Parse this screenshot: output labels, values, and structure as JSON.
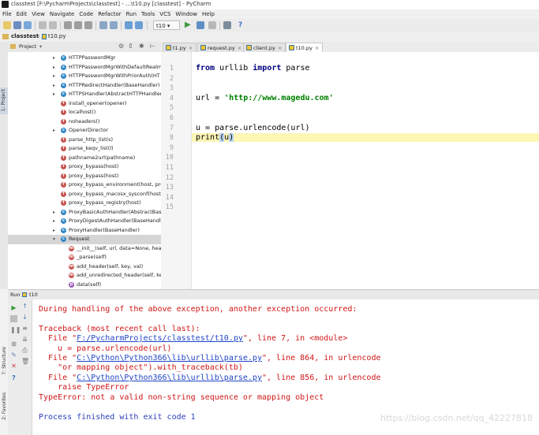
{
  "window": {
    "title": "classtest [F:\\PycharmProjects\\classtest] - ...\\t10.py [classtest] - PyCharm"
  },
  "menu": [
    "File",
    "Edit",
    "View",
    "Navigate",
    "Code",
    "Refactor",
    "Run",
    "Tools",
    "VCS",
    "Window",
    "Help"
  ],
  "toolbar": {
    "run_config": "t10",
    "help_icon": "?"
  },
  "breadcrumbs": [
    "classtest",
    "t10.py"
  ],
  "side_tools": {
    "project": "1: Project",
    "structure": "7: Structure",
    "favorites": "2: Favorites"
  },
  "project_panel": {
    "title": "Project",
    "items": [
      {
        "kind": "class",
        "label": "HTTPPasswordMgr",
        "expand": "▸",
        "indent": 0
      },
      {
        "kind": "class",
        "label": "HTTPPasswordMgrWithDefaultRealm",
        "expand": "▸",
        "indent": 0
      },
      {
        "kind": "class",
        "label": "HTTPPasswordMgrWithPriorAuth(HT",
        "expand": "▸",
        "indent": 0
      },
      {
        "kind": "class",
        "label": "HTTPRedirectHandler(BaseHandler)",
        "expand": "▸",
        "indent": 0
      },
      {
        "kind": "class",
        "label": "HTTPSHandler(AbstractHTTPHandler",
        "expand": "▸",
        "indent": 0
      },
      {
        "kind": "func",
        "label": "install_opener(opener)",
        "expand": "",
        "indent": 0
      },
      {
        "kind": "func",
        "label": "localhost()",
        "expand": "",
        "indent": 0
      },
      {
        "kind": "func",
        "label": "noheaders()",
        "expand": "",
        "indent": 0
      },
      {
        "kind": "class",
        "label": "OpenerDirector",
        "expand": "▸",
        "indent": 0
      },
      {
        "kind": "func",
        "label": "parse_http_list(s)",
        "expand": "",
        "indent": 0
      },
      {
        "kind": "func",
        "label": "parse_keqv_list(l)",
        "expand": "",
        "indent": 0
      },
      {
        "kind": "func",
        "label": "pathname2url(pathname)",
        "expand": "",
        "indent": 0
      },
      {
        "kind": "func",
        "label": "proxy_bypass(host)",
        "expand": "",
        "indent": 0
      },
      {
        "kind": "func",
        "label": "proxy_bypass(host)",
        "expand": "",
        "indent": 0
      },
      {
        "kind": "func",
        "label": "proxy_bypass_environment(host, pro",
        "expand": "",
        "indent": 0
      },
      {
        "kind": "func",
        "label": "proxy_bypass_macosx_sysconf(host)",
        "expand": "",
        "indent": 0
      },
      {
        "kind": "func",
        "label": "proxy_bypass_registry(host)",
        "expand": "",
        "indent": 0
      },
      {
        "kind": "class",
        "label": "ProxyBasicAuthHandler(AbstractBasic",
        "expand": "▸",
        "indent": 0
      },
      {
        "kind": "class",
        "label": "ProxyDigestAuthHandler(BaseHandler",
        "expand": "▸",
        "indent": 0
      },
      {
        "kind": "class",
        "label": "ProxyHandler(BaseHandler)",
        "expand": "▸",
        "indent": 0
      },
      {
        "kind": "class",
        "label": "Request",
        "expand": "▾",
        "indent": 0,
        "selected": true
      },
      {
        "kind": "method",
        "label": "__init__(self, url, data=None, head",
        "expand": "",
        "indent": 1
      },
      {
        "kind": "method",
        "label": "_parse(self)",
        "expand": "",
        "indent": 1
      },
      {
        "kind": "method",
        "label": "add_header(self, key, val)",
        "expand": "",
        "indent": 1
      },
      {
        "kind": "method",
        "label": "add_unredirected_header(self, ke",
        "expand": "",
        "indent": 1
      },
      {
        "kind": "prop",
        "label": "data(self)",
        "expand": "",
        "indent": 1
      }
    ]
  },
  "tabs": [
    {
      "label": "t1.py",
      "active": false
    },
    {
      "label": "request.py",
      "active": false
    },
    {
      "label": "client.py",
      "active": false
    },
    {
      "label": "t10.py",
      "active": true
    }
  ],
  "editor": {
    "line_numbers": [
      "1",
      "2",
      "3",
      "4",
      "5",
      "6",
      "7",
      "8",
      "9",
      "10",
      "11",
      "12",
      "13",
      "14",
      "15"
    ],
    "code": {
      "l1_kw1": "from",
      "l1_mod": " urllib ",
      "l1_kw2": "import",
      "l1_name": " parse",
      "l4_a": "url = ",
      "l4_str": "'http://www.magedu.com'",
      "l7_a": "u",
      "l7_b": " = parse.urlencode(url)",
      "l8_a": "print",
      "l8_b": "(",
      "l8_c": "u",
      "l8_d": ")"
    }
  },
  "run_panel": {
    "label": "Run",
    "config": "t10",
    "output": {
      "l1": "During handling of the above exception, another exception occurred:",
      "l2": "Traceback (most recent call last):",
      "l3_pre": "  File \"",
      "l3_link": "F:/PycharmProjects/classtest/t10.py",
      "l3_post": "\", line 7, in <module>",
      "l4": "    u = parse.urlencode(url)",
      "l5_pre": "  File \"",
      "l5_link": "C:\\Python\\Python366\\lib\\urllib\\parse.py",
      "l5_post": "\", line 864, in urlencode",
      "l6": "    \"or mapping object\").with_traceback(tb)",
      "l7_pre": "  File \"",
      "l7_link": "C:\\Python\\Python366\\lib\\urllib\\parse.py",
      "l7_post": "\", line 856, in urlencode",
      "l8": "    raise TypeError",
      "l9": "TypeError: not a valid non-string sequence or mapping object",
      "l10": "Process finished with exit code 1"
    }
  },
  "watermark": "https://blog.csdn.net/qq_42227818"
}
